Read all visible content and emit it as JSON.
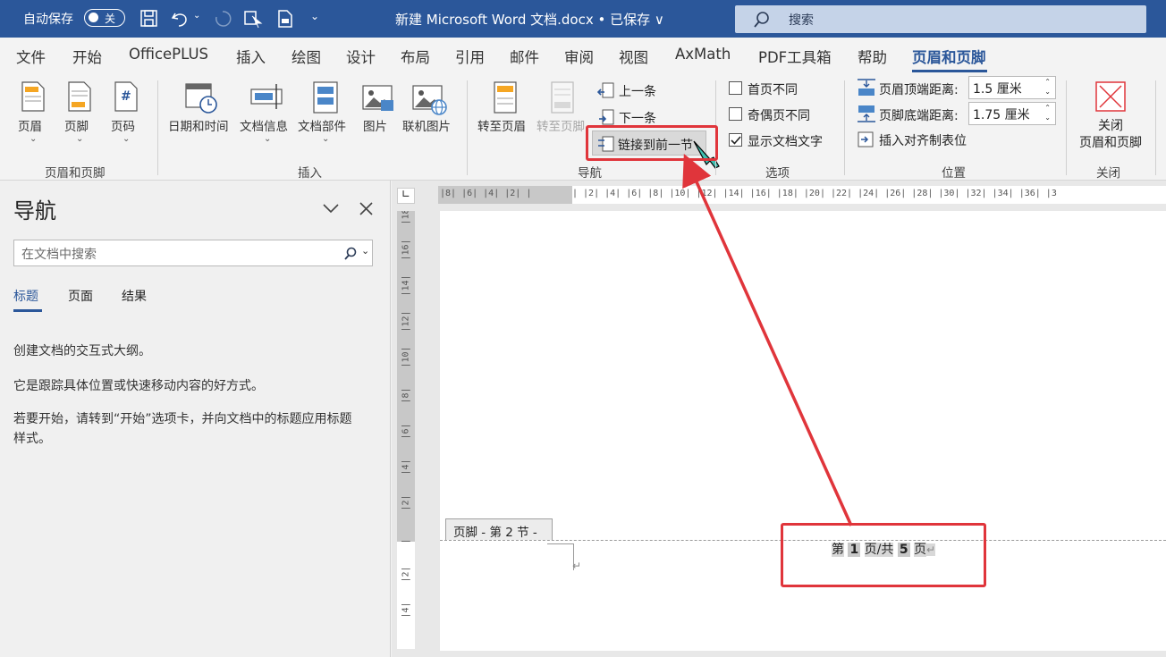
{
  "titlebar": {
    "autosave_label": "自动保存",
    "autosave_state": "关",
    "doc_title": "新建 Microsoft Word 文档.docx • 已保存 ∨",
    "search_placeholder": "搜索"
  },
  "menu": {
    "tabs": [
      "文件",
      "开始",
      "OfficePLUS",
      "插入",
      "绘图",
      "设计",
      "布局",
      "引用",
      "邮件",
      "审阅",
      "视图",
      "AxMath",
      "PDF工具箱",
      "帮助",
      "页眉和页脚"
    ],
    "active": "页眉和页脚"
  },
  "ribbon": {
    "hf_group": {
      "header": "页眉",
      "footer": "页脚",
      "page_number": "页码",
      "label": "页眉和页脚"
    },
    "insert_group": {
      "datetime": "日期和时间",
      "docinfo": "文档信息",
      "quickparts": "文档部件",
      "picture": "图片",
      "online_picture": "联机图片",
      "label": "插入"
    },
    "nav_group": {
      "goto_header": "转至页眉",
      "goto_footer": "转至页脚",
      "previous": "上一条",
      "next": "下一条",
      "link_previous": "链接到前一节",
      "label": "导航"
    },
    "options_group": {
      "diff_first": "首页不同",
      "diff_odd_even": "奇偶页不同",
      "show_text": "显示文档文字",
      "label": "选项"
    },
    "position_group": {
      "header_top_label": "页眉顶端距离:",
      "header_top_value": "1.5 厘米",
      "footer_bottom_label": "页脚底端距离:",
      "footer_bottom_value": "1.75 厘米",
      "insert_align_tab": "插入对齐制表位",
      "label": "位置"
    },
    "close_group": {
      "close_line1": "关闭",
      "close_line2": "页眉和页脚",
      "label": "关闭"
    }
  },
  "nav_pane": {
    "title": "导航",
    "search_placeholder": "在文档中搜索",
    "tabs": [
      "标题",
      "页面",
      "结果"
    ],
    "text1": "创建文档的交互式大纲。",
    "text2": "它是跟踪具体位置或快速移动内容的好方式。",
    "text3a": "若要开始，请转到“开始”选项卡，并向文档中的标题应用标题",
    "text3b": "样式。"
  },
  "document": {
    "hruler_left": "|8|  |6|  |4|  |2|  |",
    "hruler_right": "|  |2|  |4|  |6|  |8|  |10| |12| |14| |16| |18| |20| |22| |24| |26| |28| |30| |32| |34| |36| |3",
    "vruler_ticks": [
      "18",
      "16",
      "14",
      "12",
      "10",
      "8",
      "6",
      "4",
      "2",
      "",
      "2",
      "4"
    ],
    "footer_tag": "页脚 - 第 2 节 -",
    "page_text_1": "第",
    "page_field_1": "1",
    "page_text_2": "页/共",
    "page_field_2": "5",
    "page_text_3": "页",
    "return_mark": "↵"
  },
  "colors": {
    "accent": "#2b579a",
    "annotation": "#e0353b"
  }
}
